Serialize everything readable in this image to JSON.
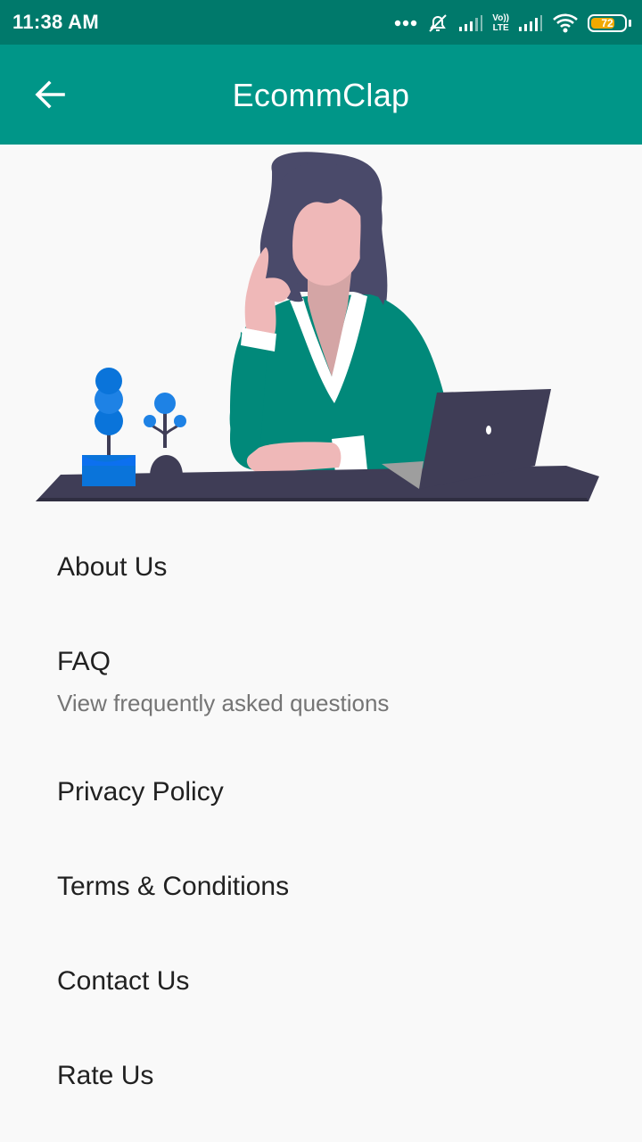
{
  "status_bar": {
    "time": "11:38 AM",
    "battery_level": "72",
    "battery_fraction": 0.72,
    "network_label_top": "Vo))",
    "network_label_bottom": "LTE",
    "battery_color": "#f2a900"
  },
  "app_bar": {
    "title": "EcommClap",
    "back_icon": "arrow-back-icon",
    "color": "#009688"
  },
  "menu": {
    "items": [
      {
        "title": "About Us"
      },
      {
        "title": "FAQ",
        "subtitle": "View frequently asked questions"
      },
      {
        "title": "Privacy Policy"
      },
      {
        "title": "Terms & Conditions"
      },
      {
        "title": "Contact Us"
      },
      {
        "title": "Rate Us"
      }
    ]
  }
}
